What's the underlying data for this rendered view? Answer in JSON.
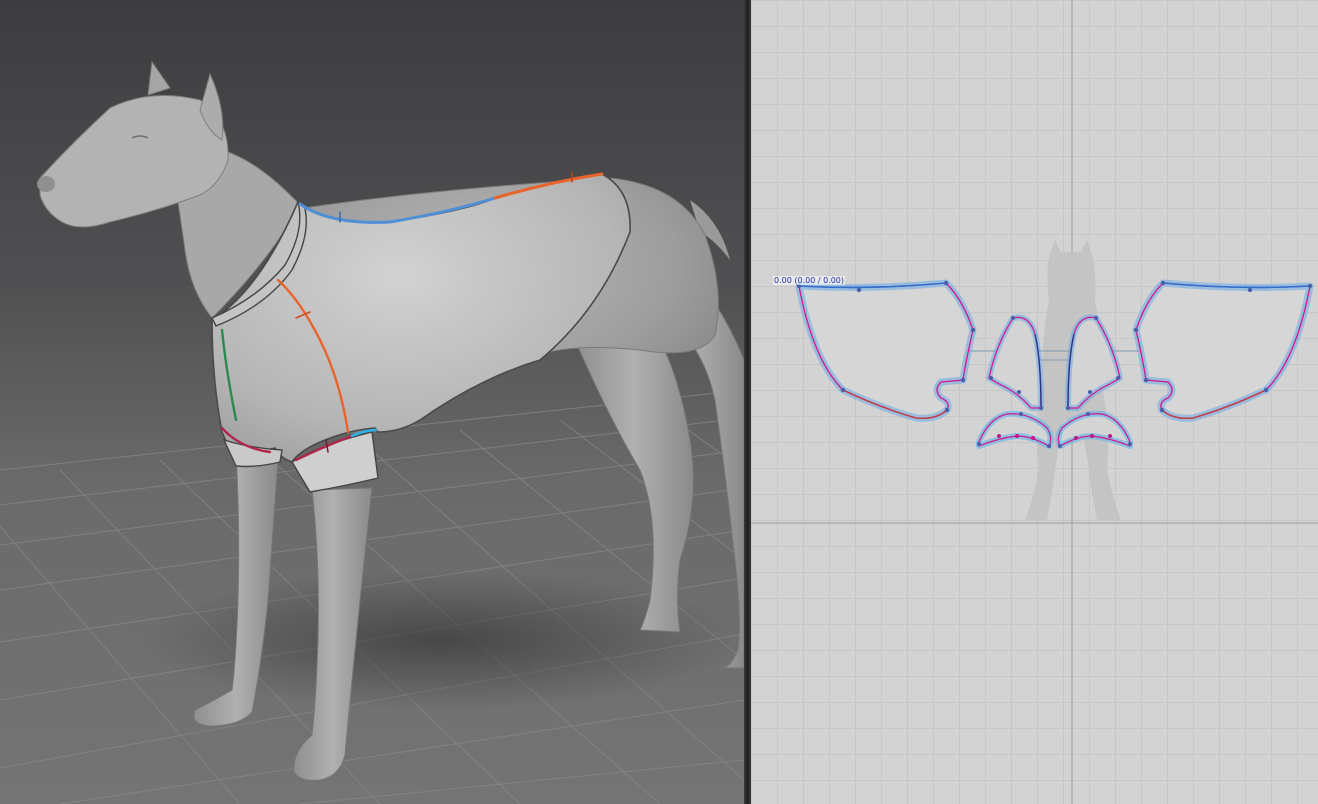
{
  "viewport_2d": {
    "coordinate_readout": "0.00 (0.00 / 0.00)"
  },
  "colors": {
    "seam_blue": "#4f8fd6",
    "seam_orange": "#e8642c",
    "seam_green": "#2d8a4e",
    "seam_crimson": "#b0264a",
    "pattern_outline": "#6aa9e6",
    "pattern_inner_line": "#d0188a"
  },
  "icons": [
    "dog-avatar-3d",
    "dog-silhouette-2d"
  ]
}
